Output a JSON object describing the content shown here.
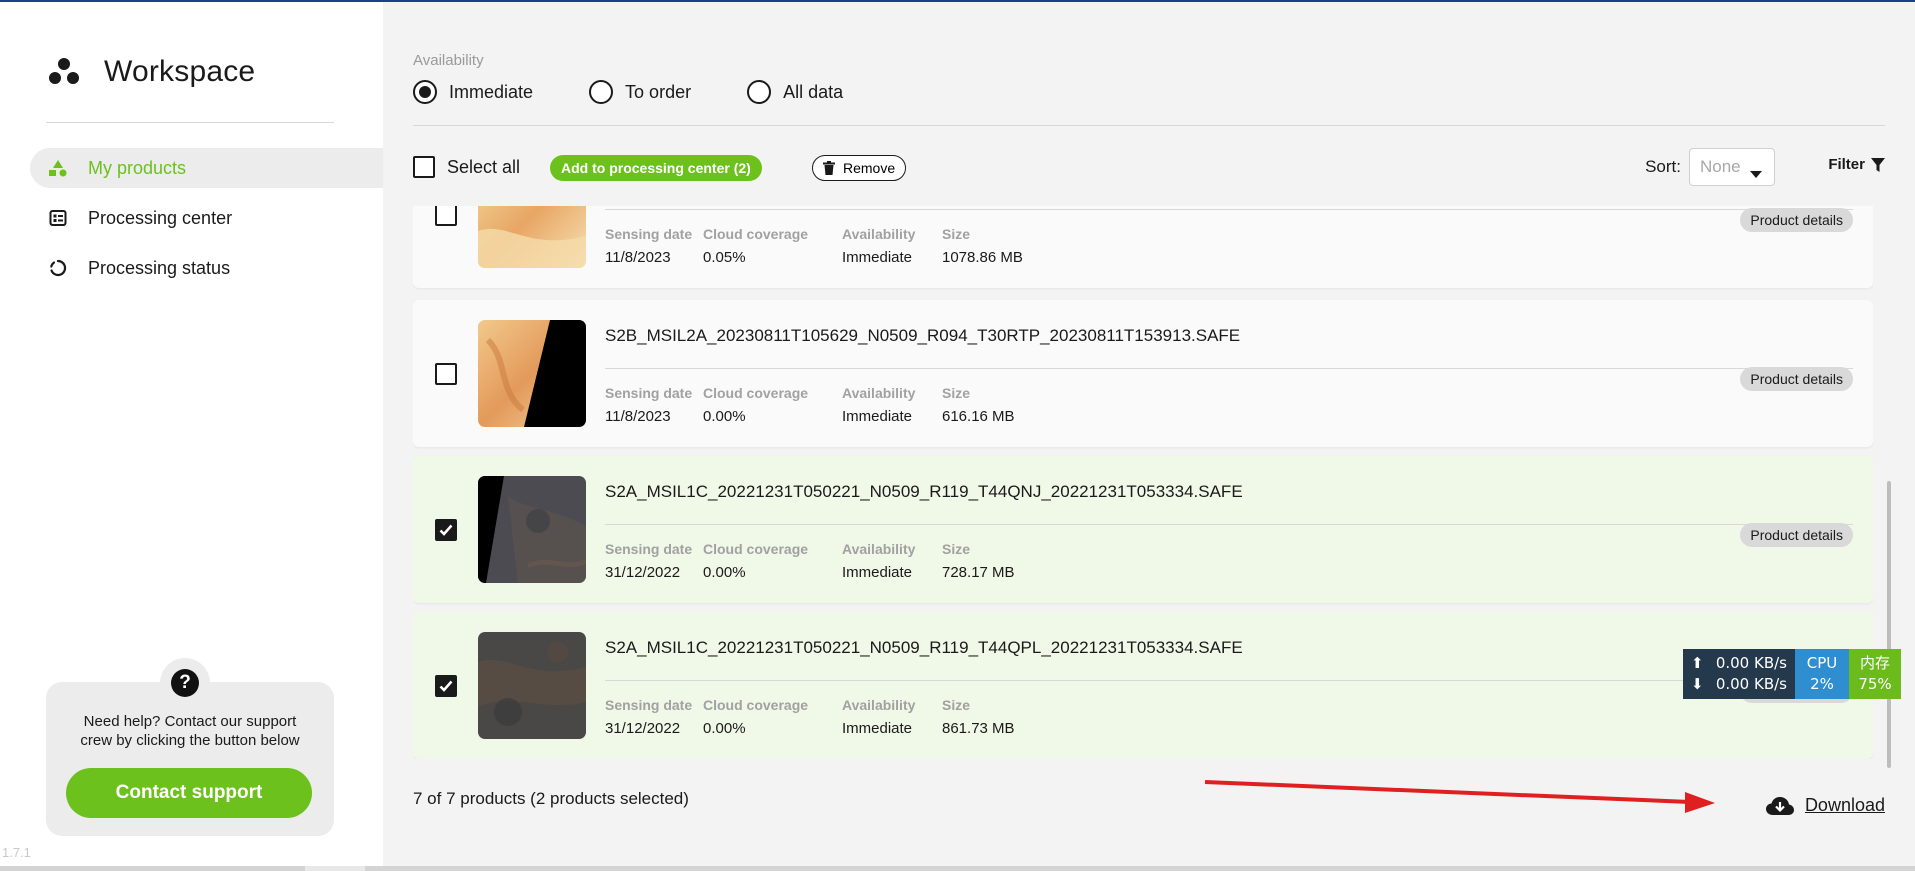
{
  "sidebar": {
    "app_title": "Workspace",
    "items": [
      {
        "label": "My products",
        "icon": "shapes-icon"
      },
      {
        "label": "Processing center",
        "icon": "processing-center-icon"
      },
      {
        "label": "Processing status",
        "icon": "loading-circle-icon"
      }
    ],
    "help": {
      "text": "Need help? Contact our support crew by clicking the button below",
      "button": "Contact support"
    },
    "version": "1.7.1"
  },
  "filters": {
    "availability_label": "Availability",
    "options": [
      "Immediate",
      "To order",
      "All data"
    ],
    "selected": "Immediate"
  },
  "toolbar": {
    "select_all": "Select all",
    "add_to_processing": "Add to processing center (2)",
    "remove": "Remove",
    "sort_label": "Sort:",
    "sort_value": "None",
    "filter": "Filter"
  },
  "field_labels": {
    "sensing_date": "Sensing date",
    "cloud_coverage": "Cloud coverage",
    "availability": "Availability",
    "size": "Size",
    "details": "Product details"
  },
  "products": [
    {
      "name": "",
      "sensing_date": "11/8/2023",
      "cloud_coverage": "0.05%",
      "availability": "Immediate",
      "size": "1078.86 MB",
      "selected": false
    },
    {
      "name": "S2B_MSIL2A_20230811T105629_N0509_R094_T30RTP_20230811T153913.SAFE",
      "sensing_date": "11/8/2023",
      "cloud_coverage": "0.00%",
      "availability": "Immediate",
      "size": "616.16 MB",
      "selected": false
    },
    {
      "name": "S2A_MSIL1C_20221231T050221_N0509_R119_T44QNJ_20221231T053334.SAFE",
      "sensing_date": "31/12/2022",
      "cloud_coverage": "0.00%",
      "availability": "Immediate",
      "size": "728.17 MB",
      "selected": true
    },
    {
      "name": "S2A_MSIL1C_20221231T050221_N0509_R119_T44QPL_20221231T053334.SAFE",
      "sensing_date": "31/12/2022",
      "cloud_coverage": "0.00%",
      "availability": "Immediate",
      "size": "861.73 MB",
      "selected": true
    }
  ],
  "footer": {
    "summary": "7 of 7 products (2 products selected)",
    "download": "Download"
  },
  "net_monitor": {
    "up": "0.00 KB/s",
    "down": "0.00 KB/s",
    "cpu_label": "CPU",
    "cpu_value": "2%",
    "mem_label": "内存",
    "mem_value": "75%"
  },
  "colors": {
    "accent": "#6cc11d",
    "selected_row": "#f0f8e8",
    "annotation_arrow": "#e02020"
  }
}
